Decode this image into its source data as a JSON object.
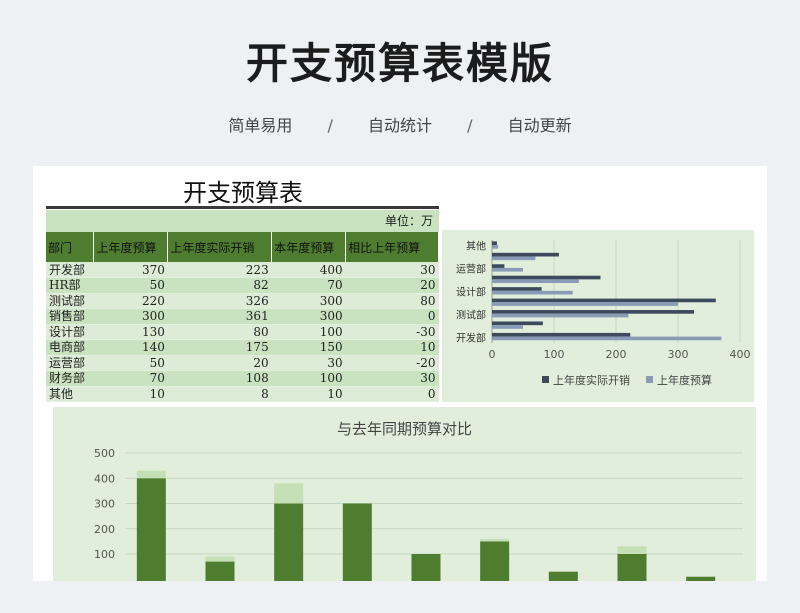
{
  "header": {
    "title": "开支预算表模版",
    "taglines": [
      "简单易用",
      "自动统计",
      "自动更新"
    ],
    "separator": "/"
  },
  "sheet": {
    "title": "开支预算表",
    "unit": "单位：万",
    "columns": [
      "部门",
      "上年度预算",
      "上年度实际开销",
      "本年度预算",
      "相比上年预算"
    ],
    "rows": [
      {
        "dept": "开发部",
        "prev_budget": "370",
        "prev_actual": "223",
        "cur_budget": "400",
        "diff": "30"
      },
      {
        "dept": "HR部",
        "prev_budget": "50",
        "prev_actual": "82",
        "cur_budget": "70",
        "diff": "20"
      },
      {
        "dept": "测试部",
        "prev_budget": "220",
        "prev_actual": "326",
        "cur_budget": "300",
        "diff": "80"
      },
      {
        "dept": "销售部",
        "prev_budget": "300",
        "prev_actual": "361",
        "cur_budget": "300",
        "diff": "0"
      },
      {
        "dept": "设计部",
        "prev_budget": "130",
        "prev_actual": "80",
        "cur_budget": "100",
        "diff": "-30"
      },
      {
        "dept": "电商部",
        "prev_budget": "140",
        "prev_actual": "175",
        "cur_budget": "150",
        "diff": "10"
      },
      {
        "dept": "运营部",
        "prev_budget": "50",
        "prev_actual": "20",
        "cur_budget": "30",
        "diff": "-20"
      },
      {
        "dept": "财务部",
        "prev_budget": "70",
        "prev_actual": "108",
        "cur_budget": "100",
        "diff": "30"
      },
      {
        "dept": "其他",
        "prev_budget": "10",
        "prev_actual": "8",
        "cur_budget": "10",
        "diff": "0"
      }
    ]
  },
  "colors": {
    "header_green": "#4f7d2f",
    "row_light": "#ddecd7",
    "row_dark": "#c9e2c0",
    "bar_dark": "#3d4a5c",
    "bar_light": "#8a9bb8",
    "col_dark": "#4f7d2f",
    "col_light": "#c5dfb7"
  },
  "chart_data": [
    {
      "type": "bar",
      "orientation": "horizontal",
      "title": "",
      "categories": [
        "开发部",
        "HR部",
        "测试部",
        "销售部",
        "设计部",
        "电商部",
        "运营部",
        "财务部",
        "其他"
      ],
      "tick_labels_shown": [
        "开发部",
        "测试部",
        "设计部",
        "运营部",
        "其他"
      ],
      "series": [
        {
          "name": "上年度实际开销",
          "values": [
            223,
            82,
            326,
            361,
            80,
            175,
            20,
            108,
            8
          ]
        },
        {
          "name": "上年度预算",
          "values": [
            370,
            50,
            220,
            300,
            130,
            140,
            50,
            70,
            10
          ]
        }
      ],
      "xlim": [
        0,
        400
      ],
      "xticks": [
        0,
        100,
        200,
        300,
        400
      ],
      "grid": true,
      "legend": "bottom"
    },
    {
      "type": "bar",
      "orientation": "vertical",
      "title": "与去年同期预算对比",
      "categories": [
        "开发部",
        "HR部",
        "测试部",
        "销售部",
        "设计部",
        "电商部",
        "运营部",
        "财务部",
        "其他"
      ],
      "series": [
        {
          "values": [
            400,
            70,
            300,
            300,
            100,
            150,
            30,
            100,
            10
          ]
        },
        {
          "values": [
            30,
            20,
            80,
            0,
            -30,
            10,
            -20,
            30,
            0
          ]
        }
      ],
      "ylim": [
        50,
        500
      ],
      "yticks": [
        100,
        200,
        300,
        400,
        500
      ],
      "grid": true,
      "legend": "none"
    }
  ]
}
